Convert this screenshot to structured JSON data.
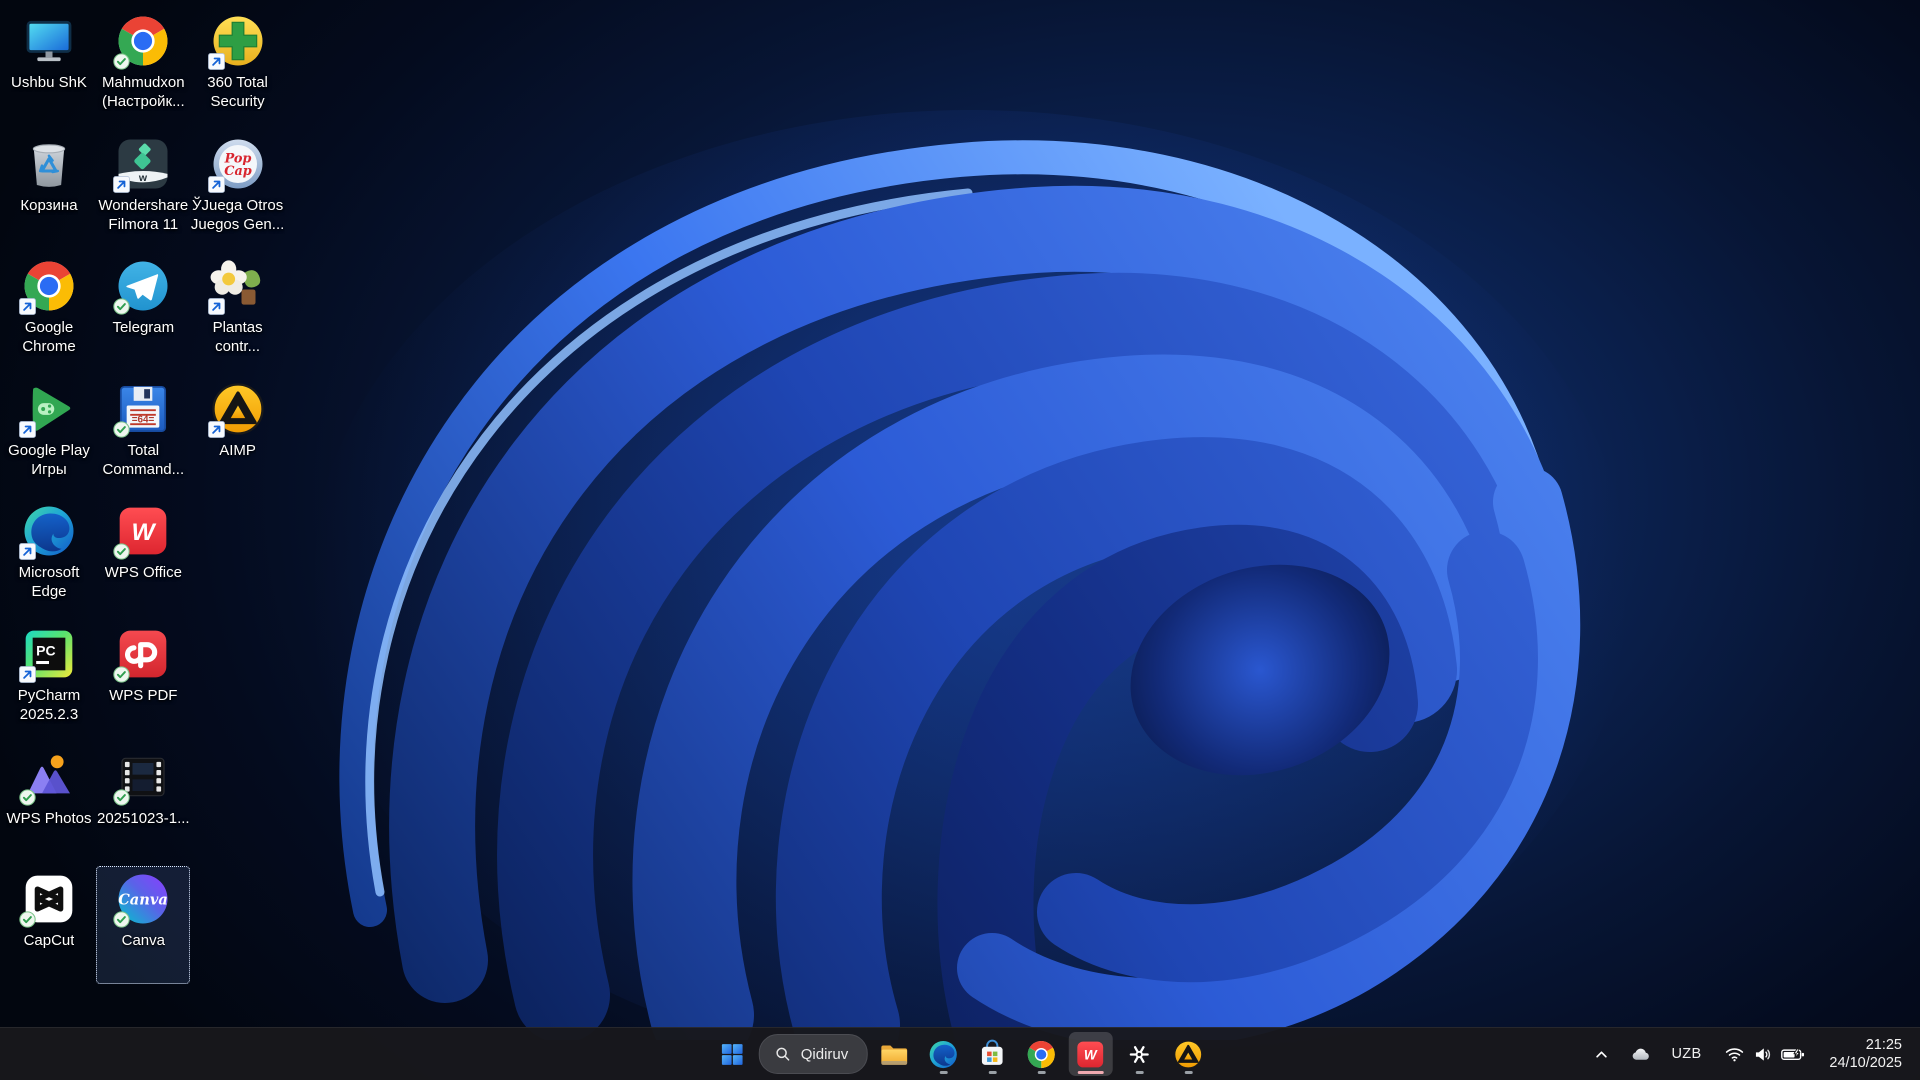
{
  "desktop": {
    "icons": [
      {
        "name": "this-pc",
        "label": "Ushbu ShK",
        "icon": "this-pc-icon",
        "badges": [],
        "col": 1,
        "row": 1
      },
      {
        "name": "mahmudxon-profile",
        "label": "Mahmudxon (Настройк...",
        "icon": "chrome-icon",
        "badges": [
          "check"
        ],
        "col": 2,
        "row": 1
      },
      {
        "name": "360-total-security",
        "label": "360 Total Security",
        "icon": "total-security-icon",
        "badges": [
          "shortcut"
        ],
        "col": 3,
        "row": 1
      },
      {
        "name": "recycle-bin",
        "label": "Корзина",
        "icon": "recycle-bin-icon",
        "badges": [],
        "col": 1,
        "row": 2
      },
      {
        "name": "wondershare-filmora",
        "label": "Wondershare Filmora 11",
        "icon": "filmora-icon",
        "badges": [
          "shortcut"
        ],
        "col": 2,
        "row": 2
      },
      {
        "name": "popcap-games",
        "label": "ЎJuega Otros Juegos Gen...",
        "icon": "popcap-icon",
        "badges": [
          "shortcut"
        ],
        "col": 3,
        "row": 2
      },
      {
        "name": "google-chrome",
        "label": "Google Chrome",
        "icon": "chrome-icon",
        "badges": [
          "shortcut"
        ],
        "col": 1,
        "row": 3
      },
      {
        "name": "telegram",
        "label": "Telegram",
        "icon": "telegram-icon",
        "badges": [
          "check"
        ],
        "col": 2,
        "row": 3
      },
      {
        "name": "plantas-contra",
        "label": "Plantas contr...",
        "icon": "flower-icon",
        "badges": [
          "shortcut"
        ],
        "col": 3,
        "row": 3
      },
      {
        "name": "google-play-games",
        "label": "Google Play Игры",
        "icon": "play-games-icon",
        "badges": [
          "shortcut"
        ],
        "col": 1,
        "row": 4
      },
      {
        "name": "total-commander",
        "label": "Total Command...",
        "icon": "total-commander-icon",
        "badges": [
          "check"
        ],
        "col": 2,
        "row": 4
      },
      {
        "name": "aimp",
        "label": "AIMP",
        "icon": "aimp-icon",
        "badges": [
          "shortcut"
        ],
        "col": 3,
        "row": 4
      },
      {
        "name": "microsoft-edge",
        "label": "Microsoft Edge",
        "icon": "edge-icon",
        "badges": [
          "shortcut"
        ],
        "col": 1,
        "row": 5
      },
      {
        "name": "wps-office",
        "label": "WPS Office",
        "icon": "wps-office-icon",
        "badges": [
          "check"
        ],
        "col": 2,
        "row": 5
      },
      {
        "name": "pycharm",
        "label": "PyCharm 2025.2.3",
        "icon": "pycharm-icon",
        "badges": [
          "shortcut"
        ],
        "col": 1,
        "row": 6
      },
      {
        "name": "wps-pdf",
        "label": "WPS PDF",
        "icon": "wps-pdf-icon",
        "badges": [
          "check"
        ],
        "col": 2,
        "row": 6
      },
      {
        "name": "wps-photos",
        "label": "WPS Photos",
        "icon": "wps-photos-icon",
        "badges": [
          "check"
        ],
        "col": 1,
        "row": 7
      },
      {
        "name": "video-20251023",
        "label": "20251023-1...",
        "icon": "video-file-icon",
        "badges": [
          "check"
        ],
        "col": 2,
        "row": 7
      },
      {
        "name": "capcut",
        "label": "CapCut",
        "icon": "capcut-icon",
        "badges": [
          "check"
        ],
        "col": 1,
        "row": 8
      },
      {
        "name": "canva",
        "label": "Canva",
        "icon": "canva-icon",
        "badges": [
          "check"
        ],
        "col": 2,
        "row": 8,
        "selected": true
      }
    ]
  },
  "taskbar": {
    "items": [
      {
        "type": "app",
        "name": "start",
        "icon": "windows-start-icon",
        "running": false
      },
      {
        "type": "search",
        "label": "Qidiruv"
      },
      {
        "type": "app",
        "name": "file-explorer",
        "icon": "file-explorer-icon",
        "running": false
      },
      {
        "type": "app",
        "name": "edge",
        "icon": "edge-icon",
        "running": true
      },
      {
        "type": "app",
        "name": "microsoft-store",
        "icon": "microsoft-store-icon",
        "running": true
      },
      {
        "type": "app",
        "name": "chrome",
        "icon": "chrome-icon",
        "running": true
      },
      {
        "type": "app",
        "name": "wps-office",
        "icon": "wps-office-icon",
        "running": true,
        "active": true
      },
      {
        "type": "app",
        "name": "chatgpt",
        "icon": "chatgpt-icon",
        "running": true
      },
      {
        "type": "app",
        "name": "aimp",
        "icon": "aimp-icon",
        "running": true
      }
    ],
    "tray": {
      "language": "UZB",
      "time": "21:25",
      "date": "24/10/2025"
    }
  },
  "colors": {
    "taskbar_bg": "#18181c",
    "running_indicator": "#9aa0a6",
    "active_indicator": "#f0aab1",
    "selection_border": "#dce9ff",
    "wallpaper_blue": "#2f63e0"
  }
}
